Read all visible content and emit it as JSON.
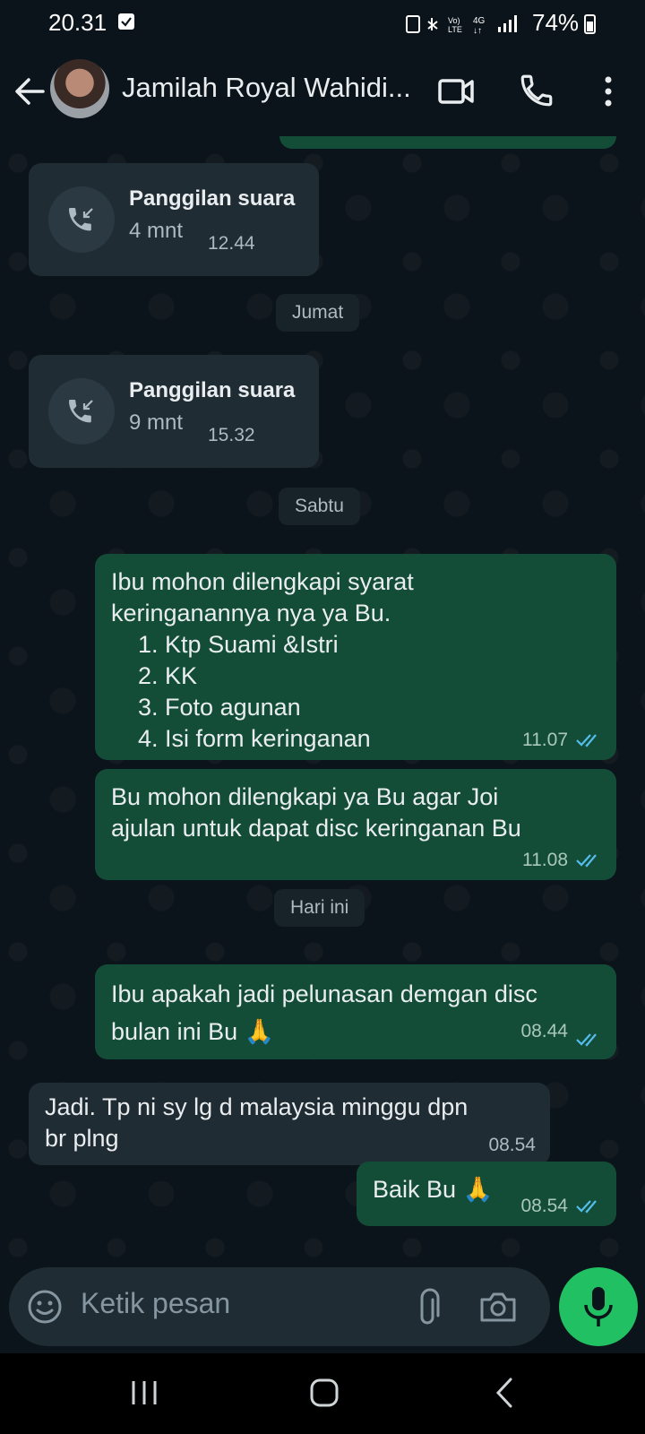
{
  "status_bar": {
    "time": "20.31",
    "battery": "74%"
  },
  "header": {
    "contact_name": "Jamilah Royal Wahidi..."
  },
  "chat": {
    "calls": [
      {
        "title": "Panggilan suara",
        "duration": "4 mnt",
        "time": "12.44"
      },
      {
        "title": "Panggilan suara",
        "duration": "9 mnt",
        "time": "15.32"
      }
    ],
    "date_chips": [
      "Jumat",
      "Sabtu",
      "Hari ini"
    ],
    "messages": [
      {
        "direction": "out",
        "text": "Ibu mohon dilengkapi syarat\nkeringanannya nya ya Bu.\n    1. Ktp Suami &Istri\n    2. KK\n    3. Foto agunan\n    4. Isi form keringanan",
        "time": "11.07"
      },
      {
        "direction": "out",
        "text": "Bu mohon dilengkapi ya Bu agar Joi\najulan untuk dapat disc keringanan Bu",
        "time": "11.08"
      },
      {
        "direction": "out",
        "text": "Ibu apakah jadi pelunasan demgan disc\nbulan ini Bu 🙏",
        "time": "08.44"
      },
      {
        "direction": "in",
        "text": "Jadi. Tp ni sy lg d malaysia minggu dpn\nbr plng",
        "time": "08.54"
      },
      {
        "direction": "out",
        "text": "Baik Bu 🙏",
        "time": "08.54"
      }
    ]
  },
  "composer": {
    "placeholder": "Ketik pesan"
  },
  "colors": {
    "outgoing_bubble": "#144d37",
    "incoming_bubble": "#202c33",
    "mic_button": "#21c063",
    "read_ticks": "#53bdeb"
  }
}
